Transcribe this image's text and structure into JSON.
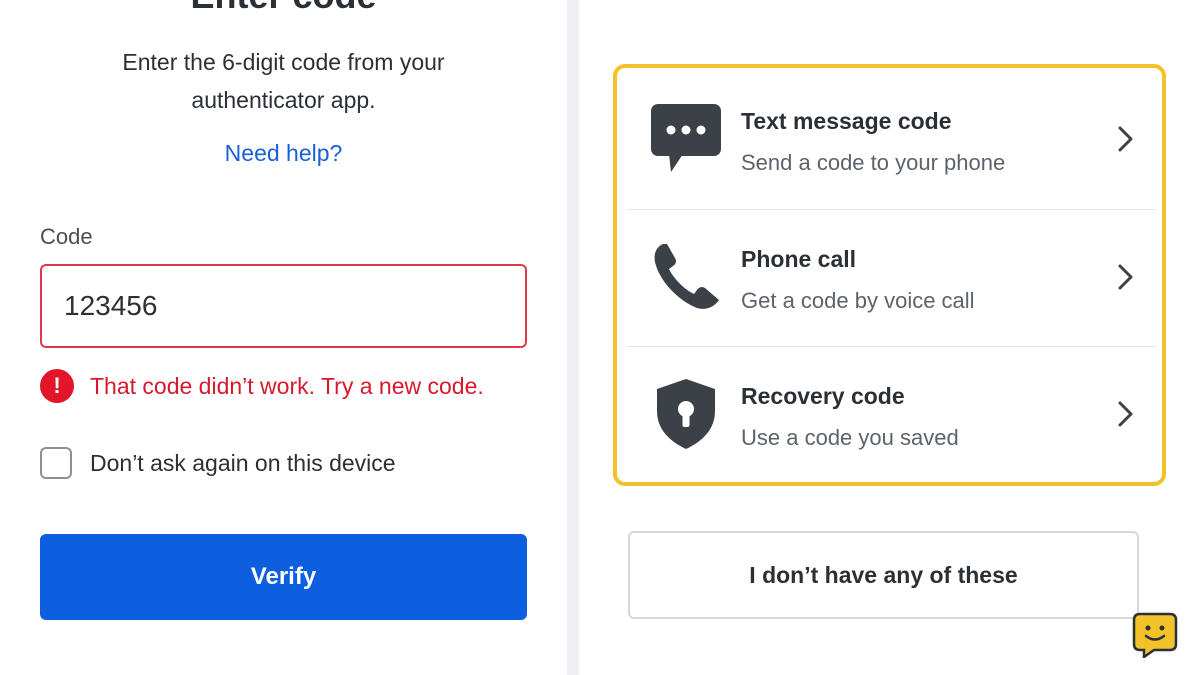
{
  "title": "Enter code",
  "instructions": "Enter the 6-digit code from your authenticator app.",
  "help_link": "Need help?",
  "code_field": {
    "label": "Code",
    "value": "123456"
  },
  "error": {
    "icon_glyph": "!",
    "message": "That code didn’t work. Try a new code."
  },
  "remember_device": {
    "label": "Don’t ask again on this device",
    "checked": false
  },
  "verify_button": "Verify",
  "options": [
    {
      "title": "Text message code",
      "description": "Send a code to your phone",
      "icon": "chat-bubble-icon"
    },
    {
      "title": "Phone call",
      "description": "Get a code by voice call",
      "icon": "phone-icon"
    },
    {
      "title": "Recovery code",
      "description": "Use a code you saved",
      "icon": "shield-lock-icon"
    }
  ],
  "alt_button": "I don’t have any of these",
  "colors": {
    "primary": "#0d5fe0",
    "error": "#e3152a",
    "highlight": "#f3c22b",
    "link": "#1a5fd6"
  }
}
